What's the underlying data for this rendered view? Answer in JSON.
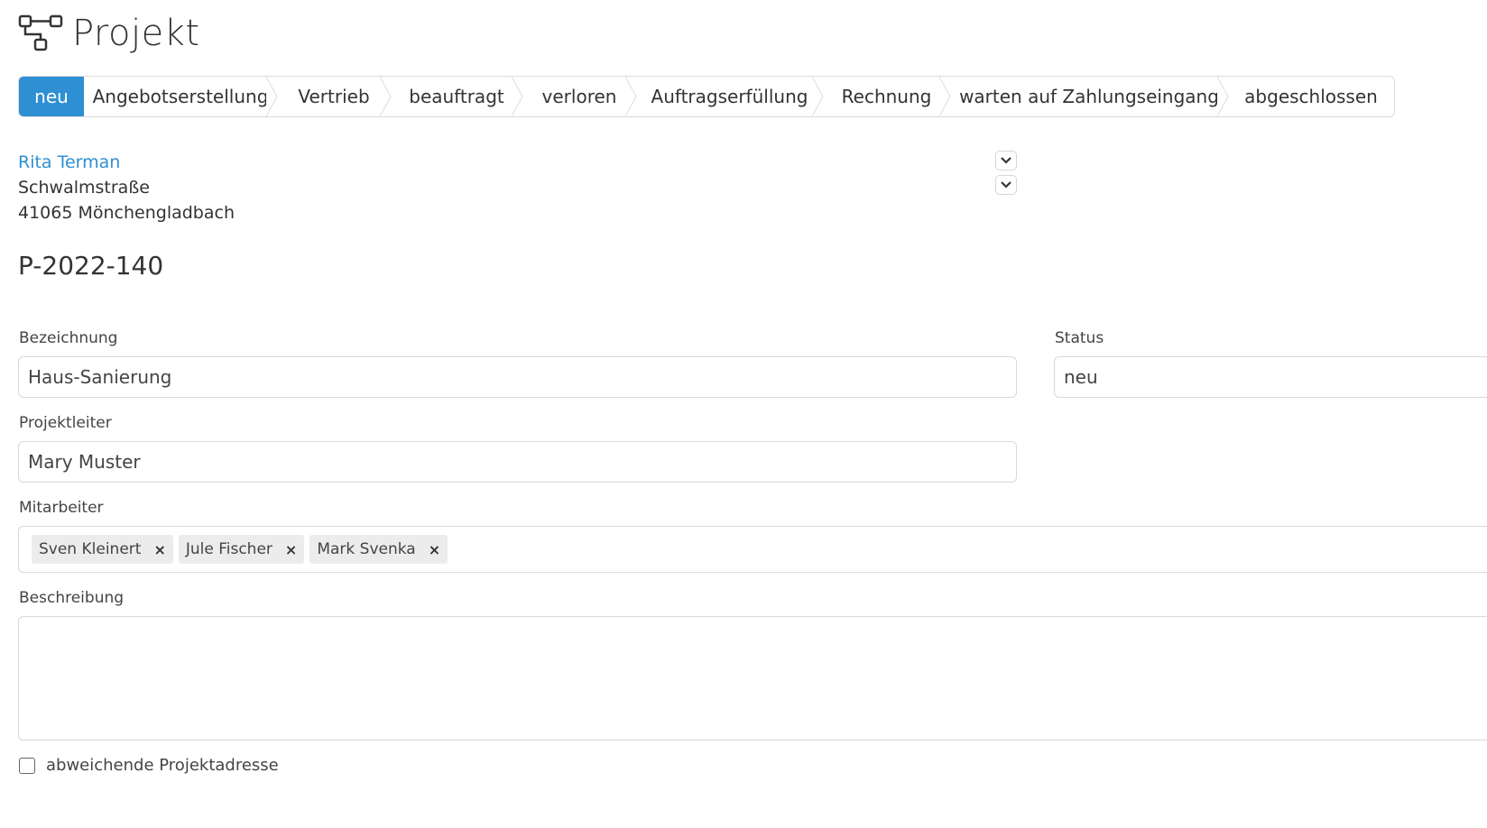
{
  "header": {
    "title": "Projekt",
    "icon": "project-tree-icon"
  },
  "pipeline": {
    "steps": [
      {
        "label": "neu",
        "active": true
      },
      {
        "label": "Angebotserstellung",
        "active": false
      },
      {
        "label": "Vertrieb",
        "active": false
      },
      {
        "label": "beauftragt",
        "active": false
      },
      {
        "label": "verloren",
        "active": false
      },
      {
        "label": "Auftragserfüllung",
        "active": false
      },
      {
        "label": "Rechnung",
        "active": false
      },
      {
        "label": "warten auf Zahlungseingang",
        "active": false
      },
      {
        "label": "abgeschlossen",
        "active": false
      }
    ],
    "active_color": "#2f8fd3"
  },
  "customer": {
    "name": "Rita Terman",
    "street": "Schwalmstraße",
    "city": "41065 Mönchengladbach"
  },
  "project_number": "P-2022-140",
  "form": {
    "bezeichnung_label": "Bezeichnung",
    "bezeichnung_value": "Haus-Sanierung",
    "status_label": "Status",
    "status_value": "neu",
    "projektleiter_label": "Projektleiter",
    "projektleiter_value": "Mary Muster",
    "mitarbeiter_label": "Mitarbeiter",
    "mitarbeiter": [
      "Sven Kleinert",
      "Jule Fischer",
      "Mark Svenka"
    ],
    "tag_remove": "×",
    "beschreibung_label": "Beschreibung",
    "beschreibung_value": "",
    "checkbox_label": "abweichende Projektadresse"
  },
  "colors": {
    "link": "#2f8fd3",
    "border": "#d9d9d9"
  }
}
